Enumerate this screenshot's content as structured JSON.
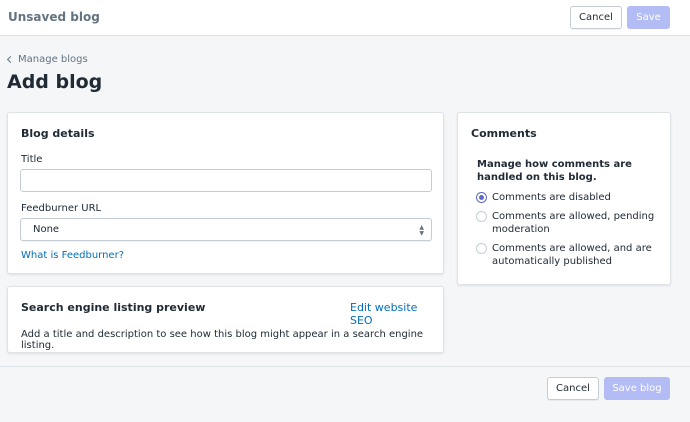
{
  "topbar": {
    "title": "Unsaved blog",
    "cancel_label": "Cancel",
    "save_label": "Save"
  },
  "breadcrumb": {
    "label": "Manage blogs"
  },
  "page": {
    "title": "Add blog"
  },
  "blog_details": {
    "heading": "Blog details",
    "title_label": "Title",
    "title_value": "",
    "feedburner_label": "Feedburner URL",
    "feedburner_selected": "None",
    "feedburner_help_link": "What is Feedburner?"
  },
  "seo": {
    "heading": "Search engine listing preview",
    "edit_link": "Edit website SEO",
    "description": "Add a title and description to see how this blog might appear in a search engine listing."
  },
  "comments": {
    "heading": "Comments",
    "description_line1": "Manage how comments are",
    "description_line2": "handled on this blog.",
    "options": [
      {
        "line1": "Comments are disabled",
        "line2": "",
        "checked": true
      },
      {
        "line1": "Comments are allowed, pending",
        "line2": "moderation",
        "checked": false
      },
      {
        "line1": "Comments are allowed, and are",
        "line2": "automatically published",
        "checked": false
      }
    ]
  },
  "footer": {
    "cancel_label": "Cancel",
    "save_label": "Save blog"
  },
  "colors": {
    "primary_disabled": "#b3bcf5",
    "link": "#006fbb",
    "radio_checked": "#5c6ac4"
  }
}
